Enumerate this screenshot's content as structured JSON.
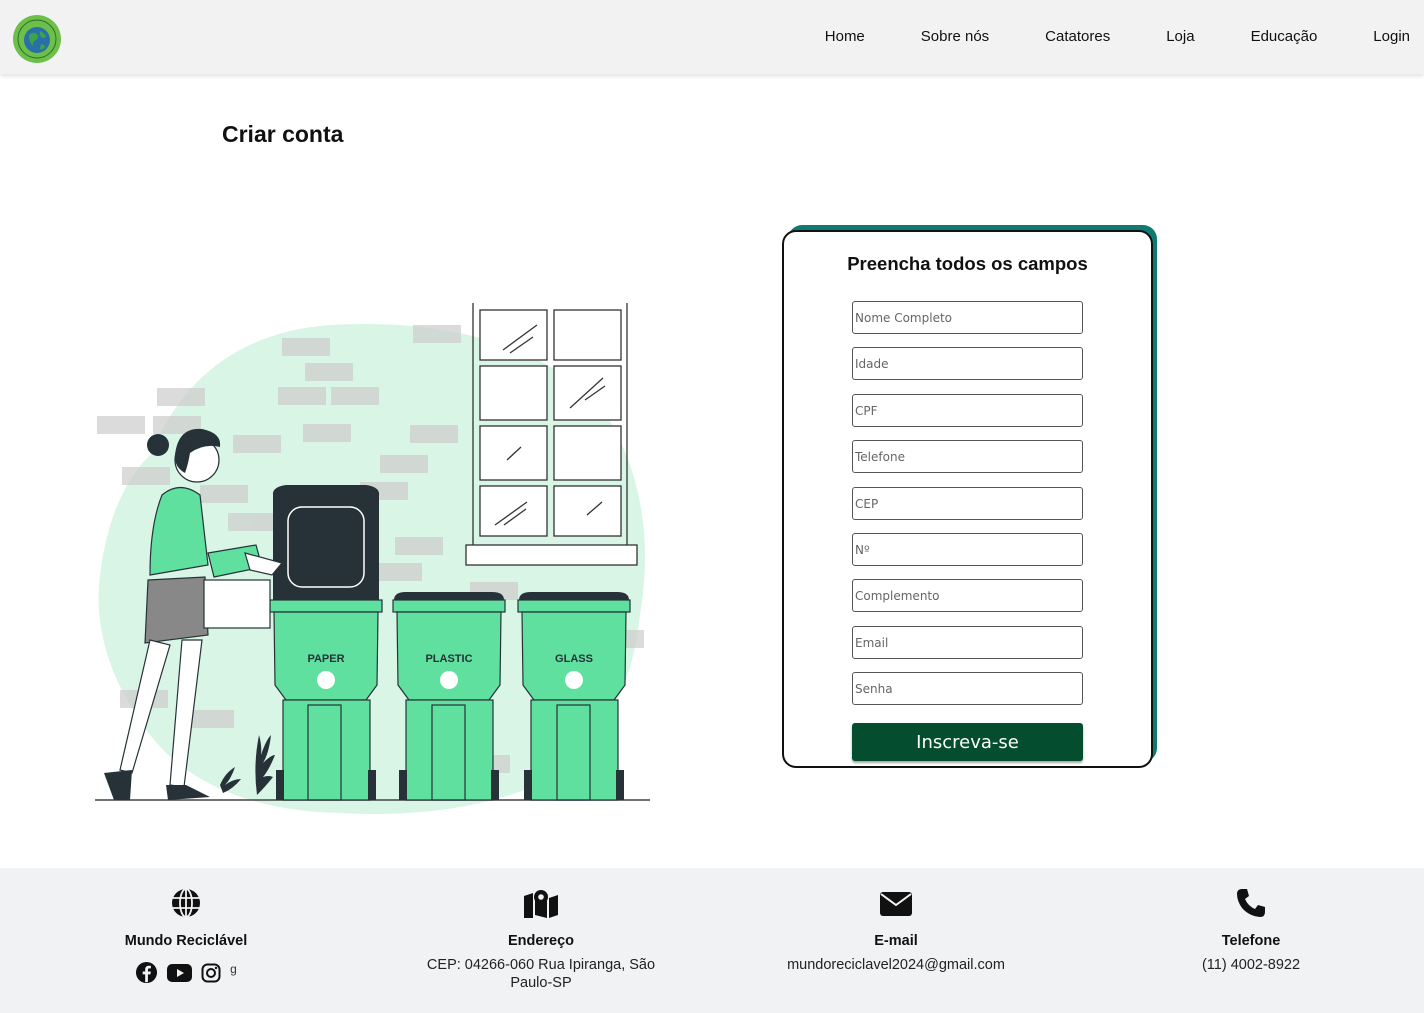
{
  "nav": {
    "items": [
      "Home",
      "Sobre nós",
      "Catatores",
      "Loja",
      "Educação",
      "Login"
    ]
  },
  "page": {
    "title": "Criar conta"
  },
  "illustration": {
    "bin_labels": [
      "PAPER",
      "PLASTIC",
      "GLASS"
    ]
  },
  "form": {
    "title": "Preencha todos os campos",
    "fields": [
      {
        "placeholder": "Nome Completo",
        "value": ""
      },
      {
        "placeholder": "Idade",
        "value": ""
      },
      {
        "placeholder": "CPF",
        "value": ""
      },
      {
        "placeholder": "Telefone",
        "value": ""
      },
      {
        "placeholder": "CEP",
        "value": ""
      },
      {
        "placeholder": "Nº",
        "value": ""
      },
      {
        "placeholder": "Complemento",
        "value": ""
      },
      {
        "placeholder": "Email",
        "value": ""
      },
      {
        "placeholder": "Senha",
        "value": ""
      }
    ],
    "submit_label": "Inscreva-se"
  },
  "footer": {
    "brand": {
      "title": "Mundo Reciclável",
      "icon": "globe-icon",
      "social_extra": "g"
    },
    "address": {
      "title": "Endereço",
      "text": "CEP: 04266-060 Rua Ipiranga, São Paulo-SP",
      "icon": "map-pin-icon"
    },
    "email": {
      "title": "E-mail",
      "text": "mundoreciclavel2024@gmail.com",
      "icon": "envelope-icon"
    },
    "phone": {
      "title": "Telefone",
      "text": "(11) 4002-8922",
      "icon": "phone-icon"
    }
  },
  "colors": {
    "accent_dark": "#044d2e",
    "card_shadow": "#0f7a72",
    "bin_green": "#5fe09f",
    "blob_mint": "#d8f5e6"
  }
}
